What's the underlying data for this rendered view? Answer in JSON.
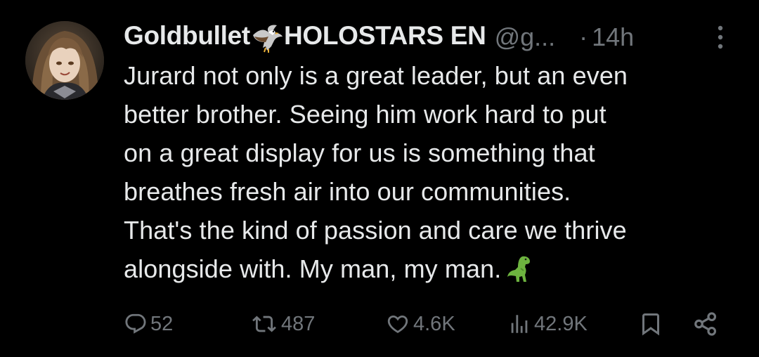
{
  "tweet": {
    "author": {
      "display_name_part1": "Goldbullet",
      "display_name_part2": "HOLOSTARS EN",
      "name_emoji_icon": "eagle-icon",
      "handle": "@g...",
      "separator": "·",
      "time": "14h"
    },
    "text_lines": [
      "Jurard not only is a great leader, but an even",
      "better brother. Seeing him work hard to put",
      "on a great display for us is something that",
      "breathes fresh air into our communities.",
      "That's the kind of passion and care we thrive",
      "alongside with. My man, my man."
    ],
    "text_emoji_icon": "dinosaur-icon",
    "actions": {
      "replies": "52",
      "reposts": "487",
      "likes": "4.6K",
      "views": "42.9K"
    },
    "icons": {
      "reply": "reply-icon",
      "repost": "repost-icon",
      "like": "heart-icon",
      "views": "views-icon",
      "bookmark": "bookmark-icon",
      "share": "share-icon",
      "more": "more-vertical-icon"
    },
    "colors": {
      "background": "#000000",
      "primary_text": "#e7e9ea",
      "secondary_text": "#71767b",
      "dino_green": "#6db33f"
    }
  }
}
